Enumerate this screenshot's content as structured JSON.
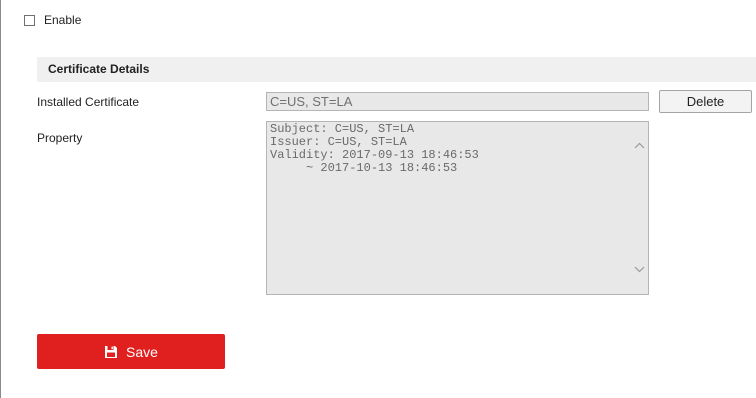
{
  "enable": {
    "label": "Enable",
    "checked": false
  },
  "section": {
    "title": "Certificate Details"
  },
  "installed_certificate": {
    "label": "Installed Certificate",
    "value": "C=US, ST=LA",
    "delete_label": "Delete"
  },
  "property": {
    "label": "Property",
    "text": "Subject: C=US, ST=LA\nIssuer: C=US, ST=LA\nValidity: 2017-09-13 18:46:53\n     ~ 2017-10-13 18:46:53"
  },
  "save": {
    "label": "Save",
    "icon": "floppy-disk-icon"
  },
  "colors": {
    "accent": "#e0201f",
    "section_bg": "#f0f0f0",
    "field_bg": "#e8e8e8"
  }
}
